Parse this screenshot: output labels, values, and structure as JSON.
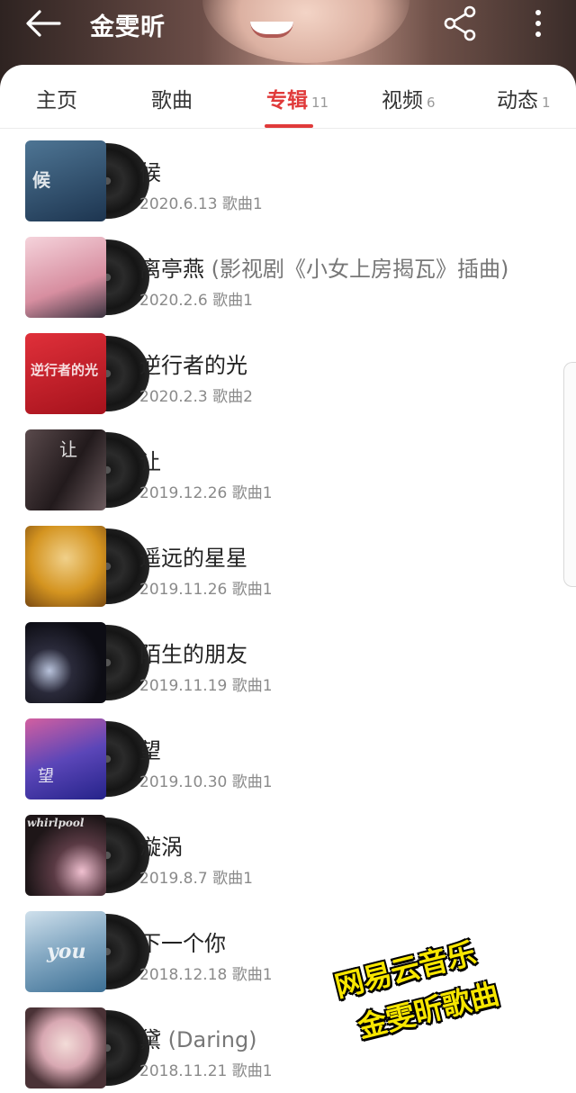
{
  "header": {
    "title": "金雯昕"
  },
  "tabs": [
    {
      "label": "主页",
      "count": ""
    },
    {
      "label": "歌曲",
      "count": ""
    },
    {
      "label": "专辑",
      "count": "11",
      "active": true
    },
    {
      "label": "视频",
      "count": "6"
    },
    {
      "label": "动态",
      "count": "1"
    }
  ],
  "accent_color": "#e03a3a",
  "albums": [
    {
      "title": "候",
      "subtitle": "",
      "meta": "2020.6.13 歌曲1",
      "cover_color": "#2c4a67",
      "cover_text": "候"
    },
    {
      "title": "离亭燕 ",
      "subtitle": "(影视剧《小女上房揭瓦》插曲)",
      "meta": "2020.2.6 歌曲1",
      "cover_color": "#e8b8c4",
      "cover_text": ""
    },
    {
      "title": "逆行者的光",
      "subtitle": "",
      "meta": "2020.2.3 歌曲2",
      "cover_color": "#c8202a",
      "cover_text": "逆行者的光"
    },
    {
      "title": "让",
      "subtitle": "",
      "meta": "2019.12.26 歌曲1",
      "cover_color": "#3a3032",
      "cover_text": "让"
    },
    {
      "title": "遥远的星星",
      "subtitle": "",
      "meta": "2019.11.26 歌曲1",
      "cover_color": "#d9a033",
      "cover_text": ""
    },
    {
      "title": "陌生的朋友",
      "subtitle": "",
      "meta": "2019.11.19 歌曲1",
      "cover_color": "#14141c",
      "cover_text": ""
    },
    {
      "title": "望",
      "subtitle": "",
      "meta": "2019.10.30 歌曲1",
      "cover_color": "#4a3c9a",
      "cover_text": "望"
    },
    {
      "title": "漩涡",
      "subtitle": "",
      "meta": "2019.8.7 歌曲1",
      "cover_color": "#2a1f22",
      "cover_text": "whirlpool"
    },
    {
      "title": "下一个你",
      "subtitle": "",
      "meta": "2018.12.18 歌曲1",
      "cover_color": "#7fa8c2",
      "cover_text": "you"
    },
    {
      "title": "黛 ",
      "subtitle": "(Daring)",
      "meta": "2018.11.21 歌曲1",
      "cover_color": "#e9c9cf",
      "cover_text": ""
    }
  ],
  "watermark": {
    "line1": "网易云音乐",
    "line2": "金雯昕歌曲"
  }
}
